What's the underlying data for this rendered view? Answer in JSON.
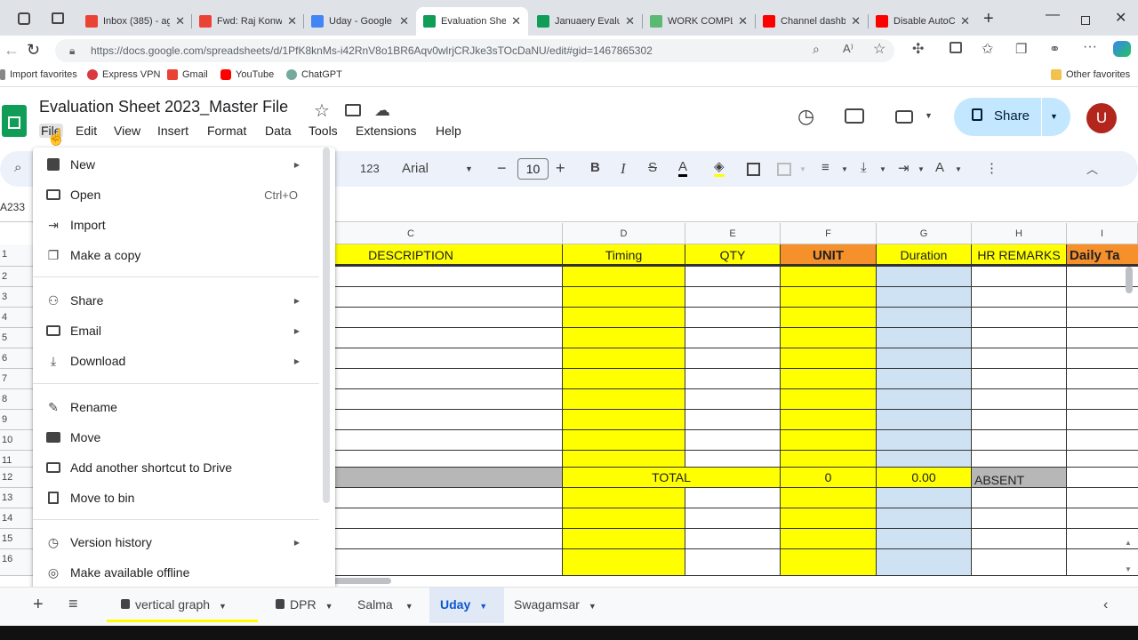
{
  "browser": {
    "tabs": [
      {
        "title": "Inbox (385) - ag",
        "favicon_color": "#ea4335"
      },
      {
        "title": "Fwd: Raj Konwa",
        "favicon_color": "#ea4335"
      },
      {
        "title": "Uday - Google D",
        "favicon_color": "#4285f4"
      },
      {
        "title": "Evaluation Shee",
        "favicon_color": "#0f9d58"
      },
      {
        "title": "Januaery Evalua",
        "favicon_color": "#0f9d58"
      },
      {
        "title": "WORK COMPLE",
        "favicon_color": "#5bb974"
      },
      {
        "title": "Channel dashbo",
        "favicon_color": "#ff0000"
      },
      {
        "title": "Disable AutoCA",
        "favicon_color": "#ff0000"
      }
    ],
    "url": "https://docs.google.com/spreadsheets/d/1PfK8knMs-i42RnV8o1BR6Aqv0wlrjCRJke3sTOcDaNU/edit#gid=1467865302",
    "bookmarks": [
      "Import favorites",
      "Express VPN",
      "Gmail",
      "YouTube",
      "ChatGPT"
    ],
    "other_favorites": "Other favorites"
  },
  "doc": {
    "title": "Evaluation Sheet 2023_Master File",
    "menus": [
      "File",
      "Edit",
      "View",
      "Insert",
      "Format",
      "Data",
      "Tools",
      "Extensions",
      "Help"
    ],
    "share_label": "Share",
    "avatar_letter": "U"
  },
  "toolbar": {
    "num_format": "123",
    "font": "Arial",
    "font_size": "10"
  },
  "sheet": {
    "name_box": "A233",
    "columns": [
      "C",
      "D",
      "E",
      "F",
      "G",
      "H",
      "I"
    ],
    "headers": {
      "c": "DESCRIPTION",
      "d": "Timing",
      "e": "QTY",
      "f": "UNIT",
      "g": "Duration",
      "h": "HR REMARKS",
      "i": "Daily Ta"
    },
    "row_numbers": [
      "1",
      "2",
      "3",
      "4",
      "5",
      "6",
      "7",
      "8",
      "9",
      "10",
      "11",
      "12",
      "13",
      "14",
      "15",
      "16"
    ],
    "total_label": "TOTAL",
    "total_unit": "0",
    "total_duration": "0.00",
    "absent_label": "ABSENT"
  },
  "file_menu": {
    "items": [
      {
        "label": "New",
        "icon": "new-icon",
        "submenu": true
      },
      {
        "label": "Open",
        "icon": "folder-icon",
        "shortcut": "Ctrl+O"
      },
      {
        "label": "Import",
        "icon": "import-icon"
      },
      {
        "label": "Make a copy",
        "icon": "copy-icon"
      },
      {
        "label": "Share",
        "icon": "person-add-icon",
        "submenu": true
      },
      {
        "label": "Email",
        "icon": "email-icon",
        "submenu": true
      },
      {
        "label": "Download",
        "icon": "download-icon",
        "submenu": true
      },
      {
        "label": "Rename",
        "icon": "pencil-icon"
      },
      {
        "label": "Move",
        "icon": "move-icon"
      },
      {
        "label": "Add another shortcut to Drive",
        "icon": "shortcut-icon"
      },
      {
        "label": "Move to bin",
        "icon": "trash-icon"
      },
      {
        "label": "Version history",
        "icon": "history-icon",
        "submenu": true
      },
      {
        "label": "Make available offline",
        "icon": "offline-icon"
      }
    ]
  },
  "sheet_tabs": [
    {
      "label": "vertical graph",
      "locked": true
    },
    {
      "label": "DPR",
      "locked": true
    },
    {
      "label": "Salma",
      "locked": false
    },
    {
      "label": "Uday",
      "locked": false,
      "active": true
    },
    {
      "label": "Swagamsar",
      "locked": false
    }
  ]
}
